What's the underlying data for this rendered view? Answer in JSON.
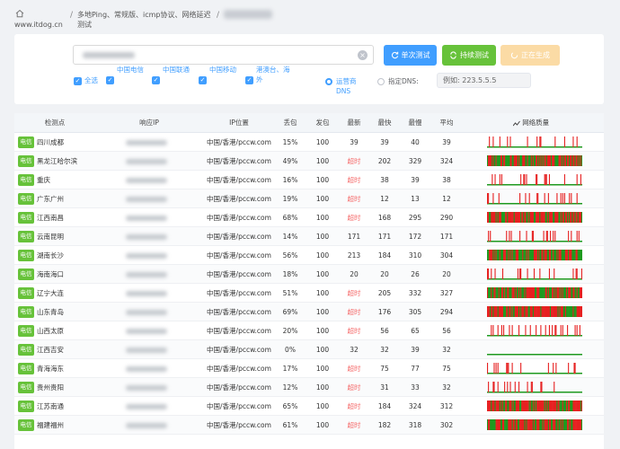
{
  "breadcrumb": {
    "site": "www.itdog.cn",
    "title": "多地Ping、常规版、icmp协议、网络延迟测试"
  },
  "controls": {
    "btn_single": "单次测试",
    "btn_continuous": "持续测试",
    "btn_generating": "正在生成",
    "checkboxes": [
      "全选",
      "中国电信",
      "中国联通",
      "中国移动",
      "港澳台、海外"
    ],
    "radio_isp": "运营商DNS",
    "radio_custom": "指定DNS:",
    "dns_placeholder": "例如: 223.5.5.5"
  },
  "table": {
    "headers": [
      "检测点",
      "响应IP",
      "IP位置",
      "丢包",
      "发包",
      "最新",
      "最快",
      "最慢",
      "平均",
      "网络质量"
    ],
    "rows": [
      {
        "isp": "电信",
        "city": "四川成都",
        "location": "中国/香港/pccw.com",
        "loss": "15%",
        "sent": "100",
        "latest": "39",
        "fastest": "39",
        "slowest": "40",
        "avg": "39",
        "quality": 0.15
      },
      {
        "isp": "电信",
        "city": "黑龙江哈尔滨",
        "location": "中国/香港/pccw.com",
        "loss": "49%",
        "sent": "100",
        "latest": "超时",
        "fastest": "202",
        "slowest": "329",
        "avg": "324",
        "quality": 0.49
      },
      {
        "isp": "电信",
        "city": "重庆",
        "location": "中国/香港/pccw.com",
        "loss": "16%",
        "sent": "100",
        "latest": "超时",
        "fastest": "38",
        "slowest": "39",
        "avg": "38",
        "quality": 0.16
      },
      {
        "isp": "电信",
        "city": "广东广州",
        "location": "中国/香港/pccw.com",
        "loss": "19%",
        "sent": "100",
        "latest": "超时",
        "fastest": "12",
        "slowest": "13",
        "avg": "12",
        "quality": 0.19
      },
      {
        "isp": "电信",
        "city": "江西南昌",
        "location": "中国/香港/pccw.com",
        "loss": "68%",
        "sent": "100",
        "latest": "超时",
        "fastest": "168",
        "slowest": "295",
        "avg": "290",
        "quality": 0.68
      },
      {
        "isp": "电信",
        "city": "云南昆明",
        "location": "中国/香港/pccw.com",
        "loss": "14%",
        "sent": "100",
        "latest": "171",
        "fastest": "171",
        "slowest": "172",
        "avg": "171",
        "quality": 0.14
      },
      {
        "isp": "电信",
        "city": "湖南长沙",
        "location": "中国/香港/pccw.com",
        "loss": "56%",
        "sent": "100",
        "latest": "213",
        "fastest": "184",
        "slowest": "310",
        "avg": "304",
        "quality": 0.56
      },
      {
        "isp": "电信",
        "city": "海南海口",
        "location": "中国/香港/pccw.com",
        "loss": "18%",
        "sent": "100",
        "latest": "20",
        "fastest": "20",
        "slowest": "26",
        "avg": "20",
        "quality": 0.18
      },
      {
        "isp": "电信",
        "city": "辽宁大连",
        "location": "中国/香港/pccw.com",
        "loss": "51%",
        "sent": "100",
        "latest": "超时",
        "fastest": "205",
        "slowest": "332",
        "avg": "327",
        "quality": 0.51
      },
      {
        "isp": "电信",
        "city": "山东青岛",
        "location": "中国/香港/pccw.com",
        "loss": "69%",
        "sent": "100",
        "latest": "超时",
        "fastest": "176",
        "slowest": "305",
        "avg": "294",
        "quality": 0.69
      },
      {
        "isp": "电信",
        "city": "山西太原",
        "location": "中国/香港/pccw.com",
        "loss": "20%",
        "sent": "100",
        "latest": "超时",
        "fastest": "56",
        "slowest": "65",
        "avg": "56",
        "quality": 0.2
      },
      {
        "isp": "电信",
        "city": "江西吉安",
        "location": "中国/香港/pccw.com",
        "loss": "0%",
        "sent": "100",
        "latest": "32",
        "fastest": "32",
        "slowest": "39",
        "avg": "32",
        "quality": 0.0
      },
      {
        "isp": "电信",
        "city": "青海海东",
        "location": "中国/香港/pccw.com",
        "loss": "17%",
        "sent": "100",
        "latest": "超时",
        "fastest": "75",
        "slowest": "77",
        "avg": "75",
        "quality": 0.17
      },
      {
        "isp": "电信",
        "city": "贵州贵阳",
        "location": "中国/香港/pccw.com",
        "loss": "12%",
        "sent": "100",
        "latest": "超时",
        "fastest": "31",
        "slowest": "33",
        "avg": "32",
        "quality": 0.12
      },
      {
        "isp": "电信",
        "city": "江苏南通",
        "location": "中国/香港/pccw.com",
        "loss": "65%",
        "sent": "100",
        "latest": "超时",
        "fastest": "184",
        "slowest": "324",
        "avg": "312",
        "quality": 0.65
      },
      {
        "isp": "电信",
        "city": "福建福州",
        "location": "中国/香港/pccw.com",
        "loss": "61%",
        "sent": "100",
        "latest": "超时",
        "fastest": "182",
        "slowest": "318",
        "avg": "302",
        "quality": 0.61
      }
    ]
  },
  "colors": {
    "primary": "#409eff",
    "success": "#67c23a",
    "danger": "#f56c6c",
    "loss_bar": "#e62020",
    "ok_bar": "#1f9a1f"
  },
  "icons": {
    "home": "home-icon",
    "refresh": "refresh-icon",
    "loop": "loop-icon",
    "chart": "chart-icon",
    "clear": "clear-icon"
  }
}
